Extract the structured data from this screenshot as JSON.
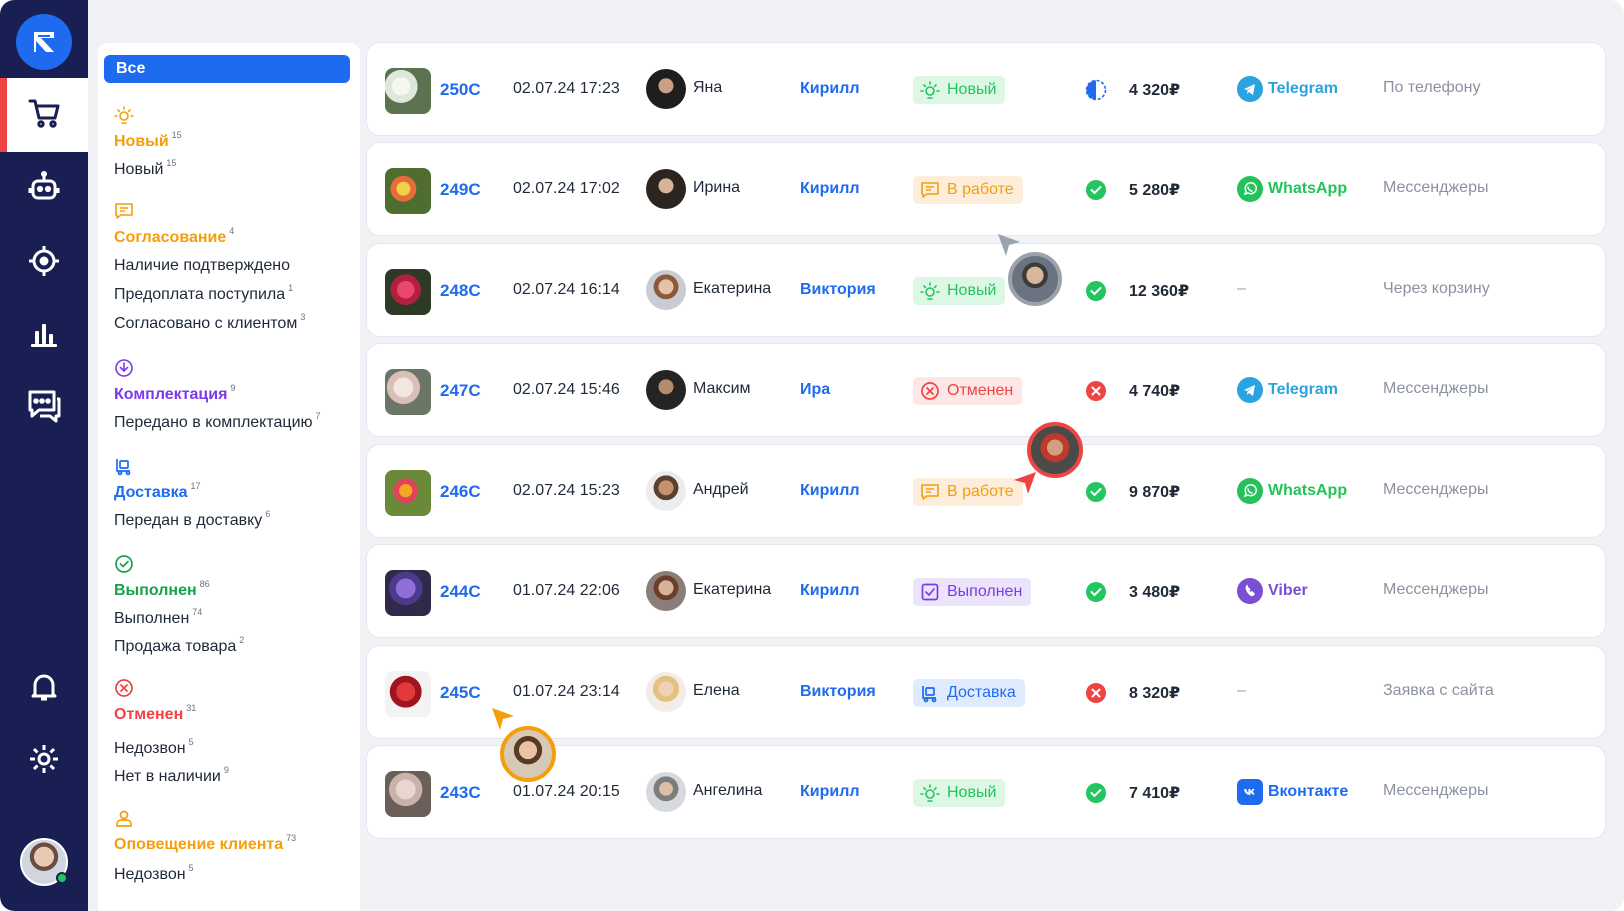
{
  "rail": {
    "logo": "logo-icon",
    "items": [
      {
        "icon": "cart-icon",
        "active": true
      },
      {
        "icon": "robot-icon",
        "active": false
      },
      {
        "icon": "target-icon",
        "active": false
      },
      {
        "icon": "chart-icon",
        "active": false
      },
      {
        "icon": "chat-icon",
        "active": false
      },
      {
        "icon": "bell-icon",
        "active": false
      },
      {
        "icon": "gear-icon",
        "active": false
      }
    ]
  },
  "filters": {
    "all": "Все",
    "groups": [
      {
        "title": "Новый",
        "count": "15",
        "color": "#f59e0b",
        "icon": "sun-icon",
        "items": [
          {
            "label": "Новый",
            "count": "15"
          }
        ]
      },
      {
        "title": "Согласование",
        "count": "4",
        "color": "#f59e0b",
        "icon": "message-icon",
        "items": [
          {
            "label": "Наличие подтверждено",
            "count": ""
          },
          {
            "label": "Предоплата поступила",
            "count": "1"
          },
          {
            "label": "Согласовано с клиентом",
            "count": "3"
          }
        ]
      },
      {
        "title": "Комплектация",
        "count": "9",
        "color": "#7c3aed",
        "icon": "download-icon",
        "items": [
          {
            "label": "Передано в комплектацию",
            "count": "7"
          }
        ]
      },
      {
        "title": "Доставка",
        "count": "17",
        "color": "#1f6bf0",
        "icon": "delivery-icon",
        "items": [
          {
            "label": "Передан в доставку",
            "count": "6"
          }
        ]
      },
      {
        "title": "Выполнен",
        "count": "86",
        "color": "#16a34a",
        "icon": "check-circle-icon",
        "items": [
          {
            "label": "Выполнен",
            "count": "74"
          },
          {
            "label": "Продажа товара",
            "count": "2"
          }
        ]
      },
      {
        "title": "Отменен",
        "count": "31",
        "color": "#ef4444",
        "icon": "x-circle-icon",
        "items": [
          {
            "label": "Недозвон",
            "count": "5"
          },
          {
            "label": "Нет в наличии",
            "count": "9"
          }
        ]
      },
      {
        "title": "Оповещение клиента",
        "count": "73",
        "color": "#f59e0b",
        "icon": "user-icon",
        "items": [
          {
            "label": "Недозвон",
            "count": "5"
          }
        ]
      }
    ]
  },
  "orders": [
    {
      "id": "250С",
      "date": "02.07.24 17:23",
      "customer": "Яна",
      "manager": "Кирилл",
      "status": "Новый",
      "status_kind": "new",
      "payment": "partial",
      "amount": "4 320₽",
      "channel": "Telegram",
      "channel_kind": "telegram",
      "source": "По телефону"
    },
    {
      "id": "249С",
      "date": "02.07.24 17:02",
      "customer": "Ирина",
      "manager": "Кирилл",
      "status": "В работе",
      "status_kind": "work",
      "payment": "paid",
      "amount": "5 280₽",
      "channel": "WhatsApp",
      "channel_kind": "whatsapp",
      "source": "Мессенджеры"
    },
    {
      "id": "248С",
      "date": "02.07.24 16:14",
      "customer": "Екатерина",
      "manager": "Виктория",
      "status": "Новый",
      "status_kind": "new",
      "payment": "paid",
      "amount": "12 360₽",
      "channel": "–",
      "channel_kind": "none",
      "source": "Через корзину"
    },
    {
      "id": "247С",
      "date": "02.07.24 15:46",
      "customer": "Максим",
      "manager": "Ира",
      "status": "Отменен",
      "status_kind": "cancel",
      "payment": "failed",
      "amount": "4 740₽",
      "channel": "Telegram",
      "channel_kind": "telegram",
      "source": "Мессенджеры"
    },
    {
      "id": "246С",
      "date": "02.07.24 15:23",
      "customer": "Андрей",
      "manager": "Кирилл",
      "status": "В работе",
      "status_kind": "work",
      "payment": "paid",
      "amount": "9 870₽",
      "channel": "WhatsApp",
      "channel_kind": "whatsapp",
      "source": "Мессенджеры"
    },
    {
      "id": "244С",
      "date": "01.07.24 22:06",
      "customer": "Екатерина",
      "manager": "Кирилл",
      "status": "Выполнен",
      "status_kind": "done",
      "payment": "paid",
      "amount": "3 480₽",
      "channel": "Viber",
      "channel_kind": "viber",
      "source": "Мессенджеры"
    },
    {
      "id": "245С",
      "date": "01.07.24 23:14",
      "customer": "Елена",
      "manager": "Виктория",
      "status": "Доставка",
      "status_kind": "delivery",
      "payment": "failed",
      "amount": "8 320₽",
      "channel": "–",
      "channel_kind": "none",
      "source": "Заявка с сайта"
    },
    {
      "id": "243С",
      "date": "01.07.24 20:15",
      "customer": "Ангелина",
      "manager": "Кирилл",
      "status": "Новый",
      "status_kind": "new",
      "payment": "paid",
      "amount": "7 410₽",
      "channel": "Вконтакте",
      "channel_kind": "vk",
      "source": "Мессенджеры"
    }
  ],
  "colors": {
    "accent": "#1f6bf0",
    "rail": "#1a1f53",
    "new": "#22c55e",
    "work": "#f59e0b",
    "cancel": "#ef4444",
    "done": "#7c3aed",
    "delivery": "#1f6bf0",
    "telegram": "#2aa3e0",
    "whatsapp": "#25c25b",
    "viber": "#7a4fd3",
    "vk": "#1f6bf0"
  }
}
